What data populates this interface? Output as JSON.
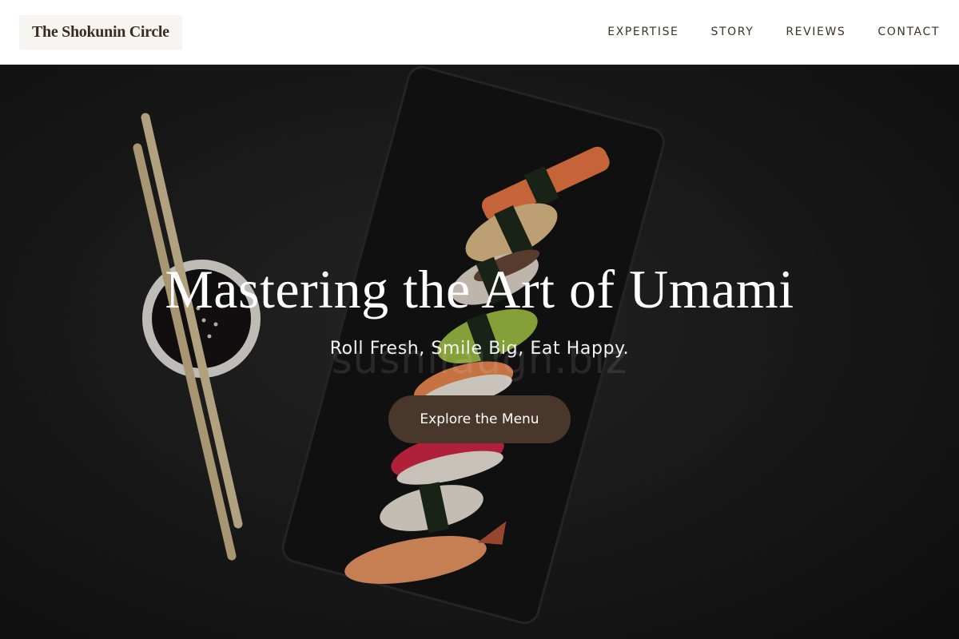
{
  "brand": {
    "name": "The Shokunin Circle"
  },
  "nav": {
    "items": [
      {
        "label": "EXPERTISE"
      },
      {
        "label": "STORY"
      },
      {
        "label": "REVIEWS"
      },
      {
        "label": "CONTACT"
      }
    ]
  },
  "hero": {
    "headline": "Mastering the Art of Umami",
    "tagline": "Roll Fresh, Smile Big, Eat Happy.",
    "watermark": "sushilaugh.biz",
    "cta_label": "Explore the Menu"
  },
  "colors": {
    "cta_bg": "#4a372c",
    "brand_text": "#3a2b22",
    "nav_text": "#3b3230"
  }
}
